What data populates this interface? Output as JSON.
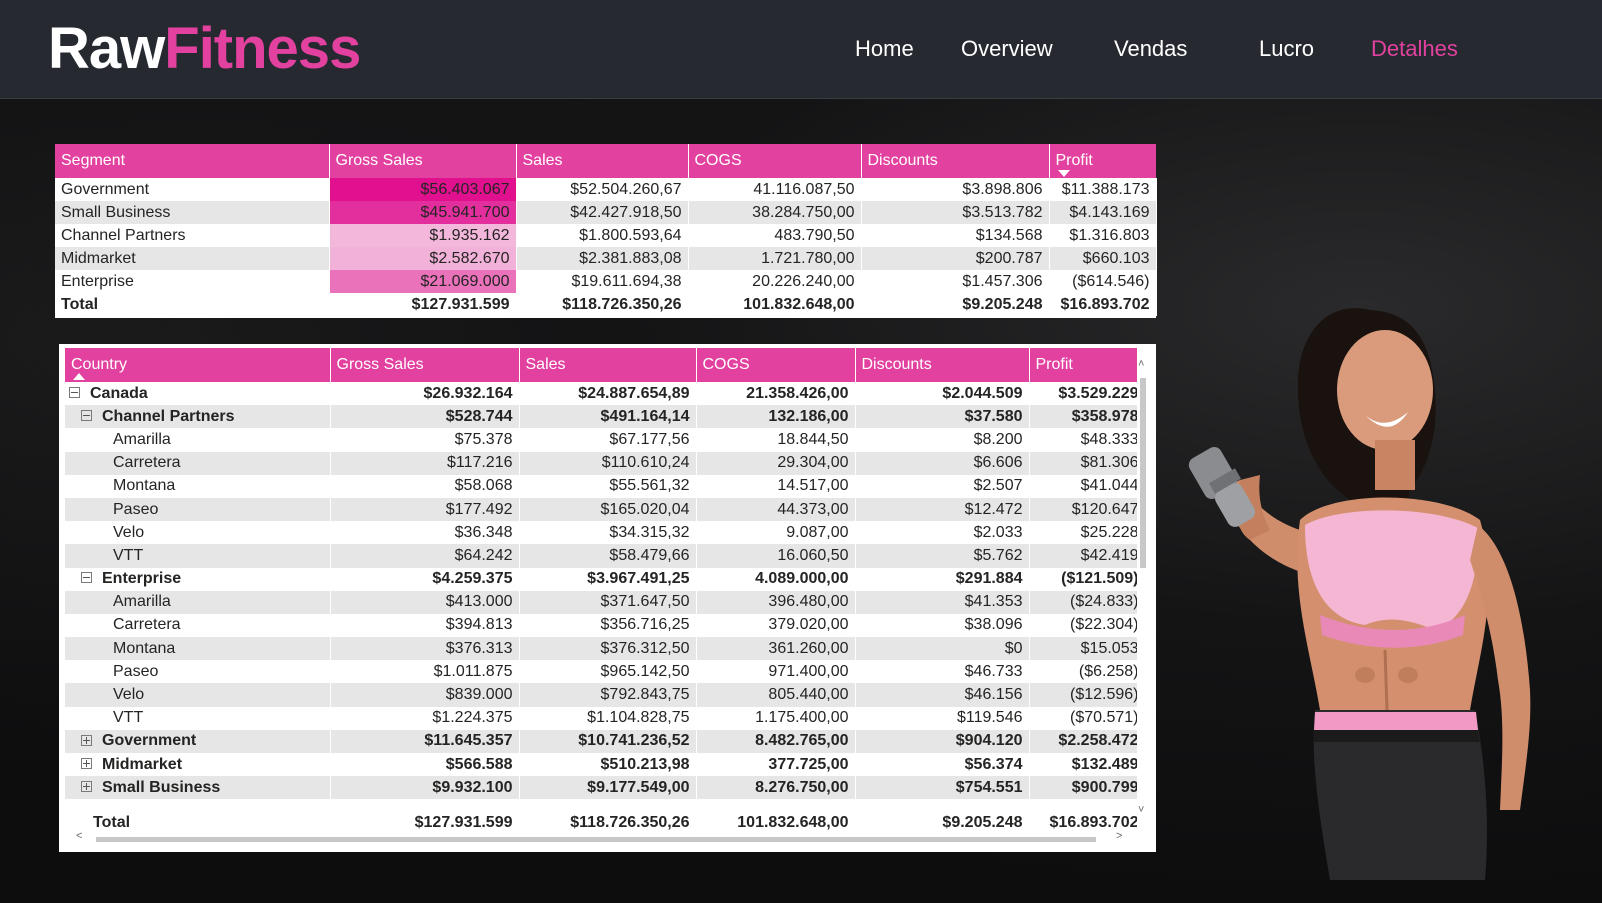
{
  "app": {
    "logo_part1": "Raw",
    "logo_part2": "Fitness",
    "accent": "#e3419f"
  },
  "nav": {
    "home": "Home",
    "overview": "Overview",
    "vendas": "Vendas",
    "lucro": "Lucro",
    "detalhes": "Detalhes",
    "active": "Detalhes"
  },
  "segment_table": {
    "headers": [
      "Segment",
      "Gross Sales",
      "Sales",
      "COGS",
      "Discounts",
      "Profit"
    ],
    "sorted_by": "Profit",
    "sort_direction": "descending",
    "rows": [
      {
        "segment": "Government",
        "gross": "$56.403.067",
        "sales": "$52.504.260,67",
        "cogs": "41.116.087,50",
        "discounts": "$3.898.806",
        "profit": "$11.388.173",
        "heat": "#e0108f"
      },
      {
        "segment": "Small Business",
        "gross": "$45.941.700",
        "sales": "$42.427.918,50",
        "cogs": "38.284.750,00",
        "discounts": "$3.513.782",
        "profit": "$4.143.169",
        "heat": "#e32f9d"
      },
      {
        "segment": "Channel Partners",
        "gross": "$1.935.162",
        "sales": "$1.800.593,64",
        "cogs": "483.790,50",
        "discounts": "$134.568",
        "profit": "$1.316.803",
        "heat": "#f4b7dc"
      },
      {
        "segment": "Midmarket",
        "gross": "$2.582.670",
        "sales": "$2.381.883,08",
        "cogs": "1.721.780,00",
        "discounts": "$200.787",
        "profit": "$660.103",
        "heat": "#f2b1d8"
      },
      {
        "segment": "Enterprise",
        "gross": "$21.069.000",
        "sales": "$19.611.694,38",
        "cogs": "20.226.240,00",
        "discounts": "$1.457.306",
        "profit": "($614.546)",
        "heat": "#ea72bb"
      }
    ],
    "total": {
      "label": "Total",
      "gross": "$127.931.599",
      "sales": "$118.726.350,26",
      "cogs": "101.832.648,00",
      "discounts": "$9.205.248",
      "profit": "$16.893.702"
    }
  },
  "country_table": {
    "headers": [
      "Country",
      "Gross Sales",
      "Sales",
      "COGS",
      "Discounts",
      "Profit"
    ],
    "sorted_by": "Country",
    "sort_direction": "ascending",
    "rows": [
      {
        "level": 0,
        "toggle": "minus",
        "label": "Canada",
        "gross": "$26.932.164",
        "sales": "$24.887.654,89",
        "cogs": "21.358.426,00",
        "discounts": "$2.044.509",
        "profit": "$3.529.229"
      },
      {
        "level": 1,
        "toggle": "minus",
        "label": "Channel Partners",
        "gross": "$528.744",
        "sales": "$491.164,14",
        "cogs": "132.186,00",
        "discounts": "$37.580",
        "profit": "$358.978"
      },
      {
        "level": 2,
        "toggle": "",
        "label": "Amarilla",
        "gross": "$75.378",
        "sales": "$67.177,56",
        "cogs": "18.844,50",
        "discounts": "$8.200",
        "profit": "$48.333"
      },
      {
        "level": 2,
        "toggle": "",
        "label": "Carretera",
        "gross": "$117.216",
        "sales": "$110.610,24",
        "cogs": "29.304,00",
        "discounts": "$6.606",
        "profit": "$81.306"
      },
      {
        "level": 2,
        "toggle": "",
        "label": "Montana",
        "gross": "$58.068",
        "sales": "$55.561,32",
        "cogs": "14.517,00",
        "discounts": "$2.507",
        "profit": "$41.044"
      },
      {
        "level": 2,
        "toggle": "",
        "label": "Paseo",
        "gross": "$177.492",
        "sales": "$165.020,04",
        "cogs": "44.373,00",
        "discounts": "$12.472",
        "profit": "$120.647"
      },
      {
        "level": 2,
        "toggle": "",
        "label": "Velo",
        "gross": "$36.348",
        "sales": "$34.315,32",
        "cogs": "9.087,00",
        "discounts": "$2.033",
        "profit": "$25.228"
      },
      {
        "level": 2,
        "toggle": "",
        "label": "VTT",
        "gross": "$64.242",
        "sales": "$58.479,66",
        "cogs": "16.060,50",
        "discounts": "$5.762",
        "profit": "$42.419"
      },
      {
        "level": 1,
        "toggle": "minus",
        "label": "Enterprise",
        "gross": "$4.259.375",
        "sales": "$3.967.491,25",
        "cogs": "4.089.000,00",
        "discounts": "$291.884",
        "profit": "($121.509)"
      },
      {
        "level": 2,
        "toggle": "",
        "label": "Amarilla",
        "gross": "$413.000",
        "sales": "$371.647,50",
        "cogs": "396.480,00",
        "discounts": "$41.353",
        "profit": "($24.833)"
      },
      {
        "level": 2,
        "toggle": "",
        "label": "Carretera",
        "gross": "$394.813",
        "sales": "$356.716,25",
        "cogs": "379.020,00",
        "discounts": "$38.096",
        "profit": "($22.304)"
      },
      {
        "level": 2,
        "toggle": "",
        "label": "Montana",
        "gross": "$376.313",
        "sales": "$376.312,50",
        "cogs": "361.260,00",
        "discounts": "$0",
        "profit": "$15.053"
      },
      {
        "level": 2,
        "toggle": "",
        "label": "Paseo",
        "gross": "$1.011.875",
        "sales": "$965.142,50",
        "cogs": "971.400,00",
        "discounts": "$46.733",
        "profit": "($6.258)"
      },
      {
        "level": 2,
        "toggle": "",
        "label": "Velo",
        "gross": "$839.000",
        "sales": "$792.843,75",
        "cogs": "805.440,00",
        "discounts": "$46.156",
        "profit": "($12.596)"
      },
      {
        "level": 2,
        "toggle": "",
        "label": "VTT",
        "gross": "$1.224.375",
        "sales": "$1.104.828,75",
        "cogs": "1.175.400,00",
        "discounts": "$119.546",
        "profit": "($70.571)"
      },
      {
        "level": 1,
        "toggle": "plus",
        "label": "Government",
        "gross": "$11.645.357",
        "sales": "$10.741.236,52",
        "cogs": "8.482.765,00",
        "discounts": "$904.120",
        "profit": "$2.258.472"
      },
      {
        "level": 1,
        "toggle": "plus",
        "label": "Midmarket",
        "gross": "$566.588",
        "sales": "$510.213,98",
        "cogs": "377.725,00",
        "discounts": "$56.374",
        "profit": "$132.489"
      },
      {
        "level": 1,
        "toggle": "plus",
        "label": "Small Business",
        "gross": "$9.932.100",
        "sales": "$9.177.549,00",
        "cogs": "8.276.750,00",
        "discounts": "$754.551",
        "profit": "$900.799"
      }
    ],
    "total": {
      "label": "Total",
      "gross": "$127.931.599",
      "sales": "$118.726.350,26",
      "cogs": "101.832.648,00",
      "discounts": "$9.205.248",
      "profit": "$16.893.702"
    }
  },
  "icons": {
    "expand": "plus-box-icon",
    "collapse": "minus-box-icon",
    "scroll_up": "chevron-up-icon",
    "scroll_down": "chevron-down-icon",
    "scroll_left": "chevron-left-icon",
    "scroll_right": "chevron-right-icon"
  },
  "image": {
    "subject": "fitness-model-with-dumbbell"
  }
}
